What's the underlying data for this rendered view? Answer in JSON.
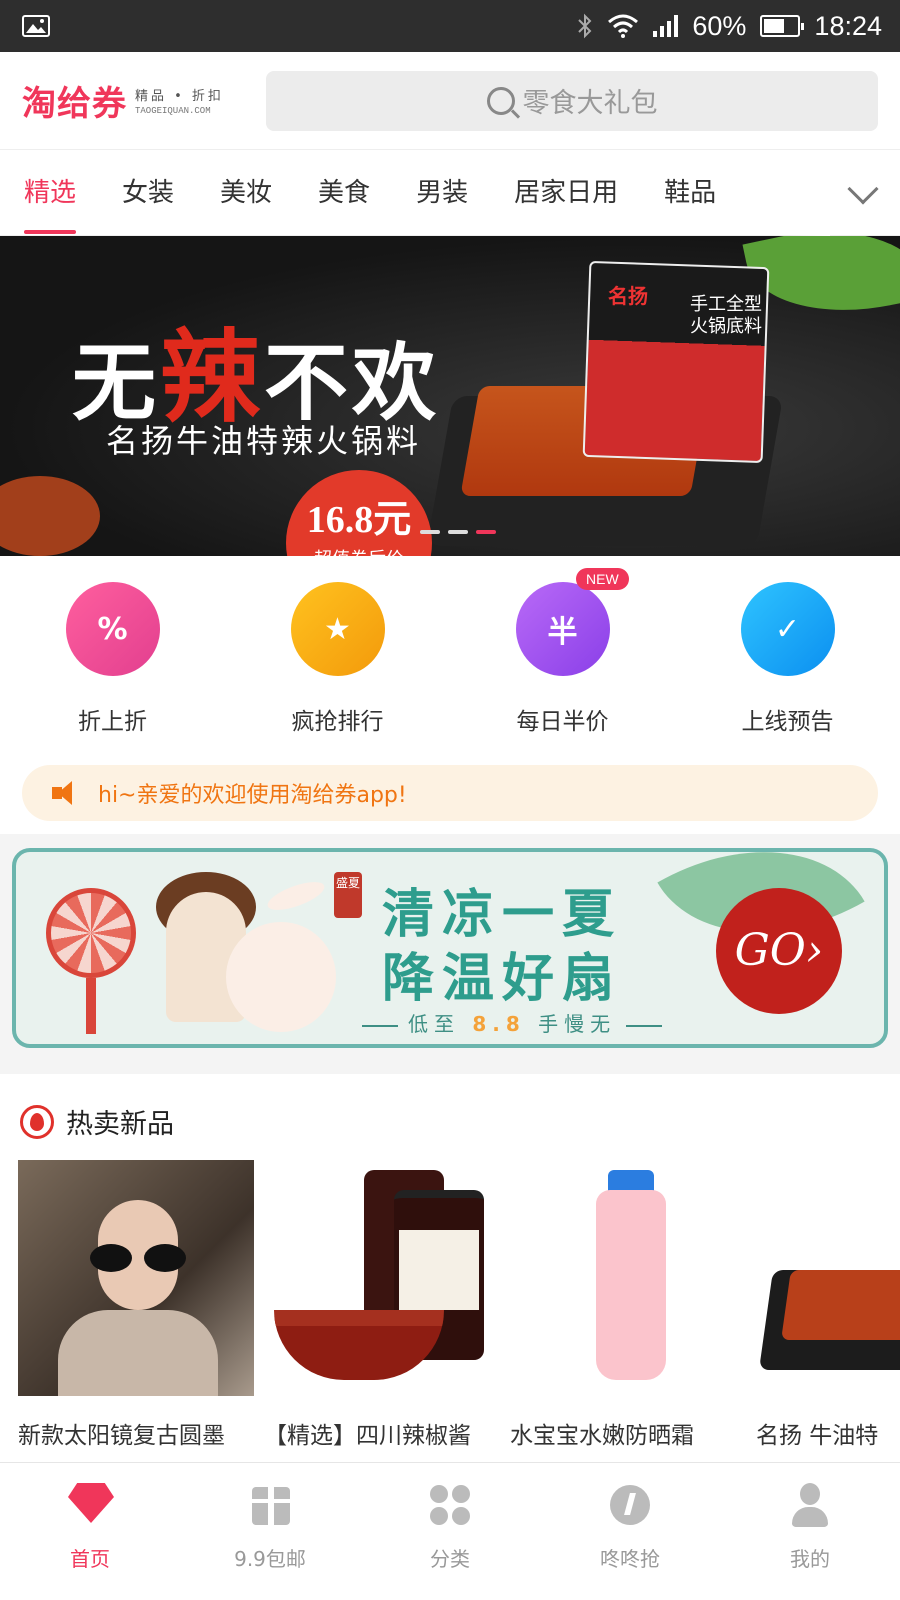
{
  "status_bar": {
    "battery": "60%",
    "time": "18:24",
    "icons": [
      "image-icon",
      "bluetooth-icon",
      "wifi-icon",
      "signal-icon",
      "battery-icon"
    ]
  },
  "header": {
    "logo": "淘给券",
    "logo_tagline": "精品 • 折扣",
    "logo_domain": "TAOGEIQUAN.COM",
    "search_placeholder": "零食大礼包"
  },
  "tabs": {
    "items": [
      "精选",
      "女装",
      "美妆",
      "美食",
      "男装",
      "居家日用",
      "鞋品"
    ],
    "active": 0
  },
  "banner": {
    "title_part1": "无",
    "title_hot": "辣",
    "title_part2": "不欢",
    "subtitle": "名扬牛油特辣火锅料",
    "price": "16.8元",
    "price_label": "超值券后价",
    "package_brand": "名扬",
    "package_text": "手工全型火锅底料",
    "slide_count": 3,
    "active_slide": 2
  },
  "quick_links": [
    {
      "label": "折上折",
      "icon": "discount-tag-icon",
      "glyph": "%"
    },
    {
      "label": "疯抢排行",
      "icon": "trophy-icon",
      "glyph": "★"
    },
    {
      "label": "每日半价",
      "icon": "calendar-half-icon",
      "glyph": "半",
      "badge": "NEW"
    },
    {
      "label": "上线预告",
      "icon": "calendar-check-icon",
      "glyph": "✓"
    }
  ],
  "notice": {
    "text": "hi~亲爱的欢迎使用淘给券app!"
  },
  "promo": {
    "seal": "盛夏",
    "title_line1": "清凉一夏",
    "title_line2": "降温好扇",
    "sub_prefix": "低至",
    "sub_price": "8.8",
    "sub_suffix": "手慢无",
    "button": "GO›"
  },
  "hot_new": {
    "title": "热卖新品",
    "products": [
      {
        "name": "新款太阳镜复古圆墨"
      },
      {
        "name": "【精选】四川辣椒酱"
      },
      {
        "name": "水宝宝水嫩防晒霜"
      },
      {
        "name": "名扬 牛油特"
      }
    ]
  },
  "bottom_nav": {
    "items": [
      {
        "label": "首页",
        "icon": "home-icon"
      },
      {
        "label": "9.9包邮",
        "icon": "gift-icon"
      },
      {
        "label": "分类",
        "icon": "category-icon"
      },
      {
        "label": "咚咚抢",
        "icon": "flash-sale-icon"
      },
      {
        "label": "我的",
        "icon": "user-icon"
      }
    ],
    "active": 0
  },
  "colors": {
    "brand": "#f0365a",
    "notice": "#f07512",
    "promo_teal": "#2e9d8d"
  }
}
